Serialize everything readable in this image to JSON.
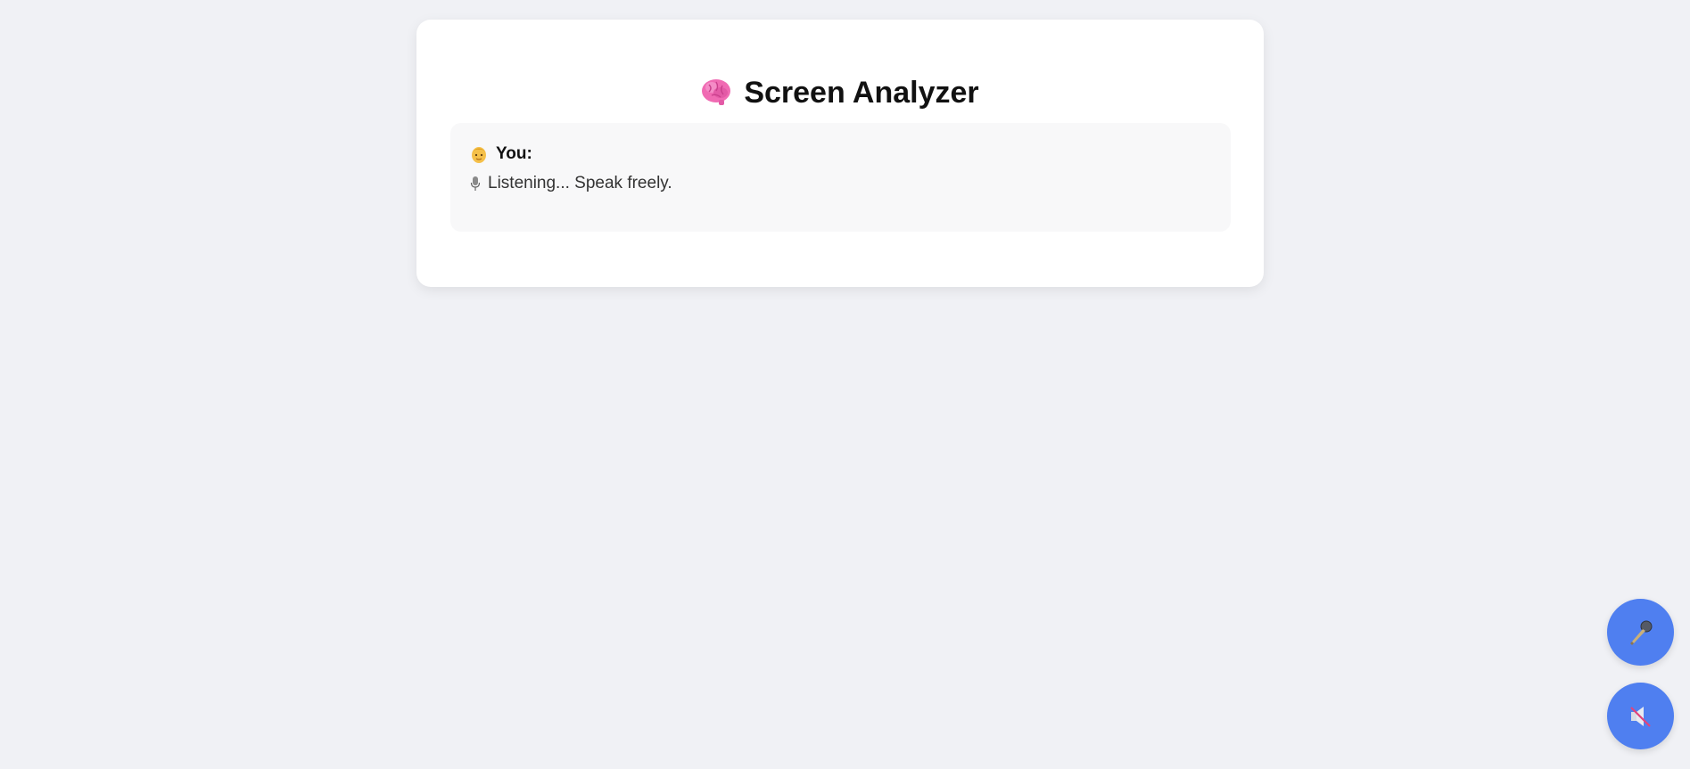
{
  "header": {
    "title": "Screen Analyzer",
    "icon": "brain-icon"
  },
  "conversation": {
    "speaker_label": "You:",
    "speaker_icon": "person-icon",
    "message": "Listening... Speak freely.",
    "message_icon": "microphone-icon"
  },
  "controls": {
    "mic_button_icon": "microphone-icon",
    "mute_button_icon": "speaker-muted-icon",
    "accent_color": "#4f7ff0"
  }
}
